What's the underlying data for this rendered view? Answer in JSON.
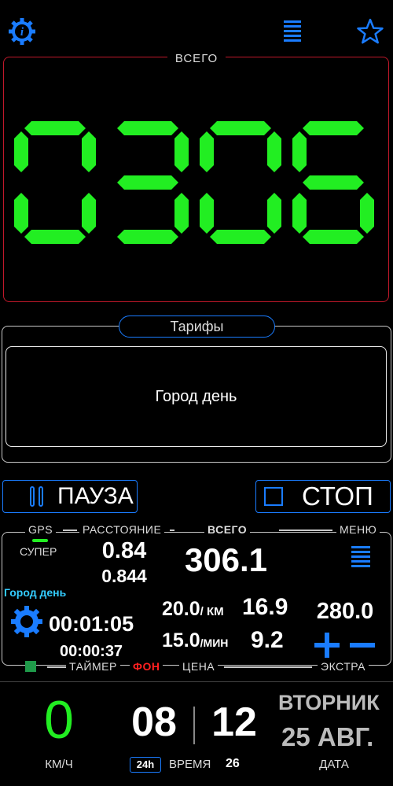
{
  "top": {
    "info_icon": "info-gear-icon",
    "menu_icon": "list-menu-icon",
    "star_icon": "star-icon"
  },
  "total": {
    "label": "ВСЕГО",
    "display": "0306"
  },
  "tariffs": {
    "title": "Тарифы",
    "selected": "Город день"
  },
  "buttons": {
    "pause": "ПАУЗА",
    "stop": "СТОП"
  },
  "info": {
    "gps": "GPS",
    "gps_quality": "СУПЕР",
    "distance_label": "РАССТОЯНИЕ",
    "distance_main": "0.84",
    "distance_sub": "0.844",
    "total_label": "ВСЕГО",
    "total_value": "306.1",
    "menu_label": "МЕНЮ",
    "tariff_name": "Город день",
    "timer_main": "00:01:05",
    "timer_sub": "00:00:37",
    "rate_km": "20.0",
    "rate_km_unit": "/ КМ",
    "rate_km_sum": "16.9",
    "rate_min": "15.0",
    "rate_min_unit": "/МИН",
    "rate_min_sum": "9.2",
    "extra_value": "280.0",
    "timer_label": "ТАЙМЕР",
    "background_label": "ФОН",
    "price_label": "ЦЕНА",
    "extra_label": "ЭКСТРА"
  },
  "bottom": {
    "speed": "0",
    "speed_unit": "КМ/Ч",
    "hours": "08",
    "minutes": "12",
    "format_badge": "24h",
    "time_label": "ВРЕМЯ",
    "seconds": "26",
    "weekday": "ВТОРНИК",
    "date": "25 АВГ.",
    "date_label": "ДАТА"
  },
  "colors": {
    "accent": "#1a7cff",
    "digits": "#22ee22",
    "alert": "#c0182a",
    "red_text": "#ff2020",
    "cyan": "#33ccff"
  }
}
